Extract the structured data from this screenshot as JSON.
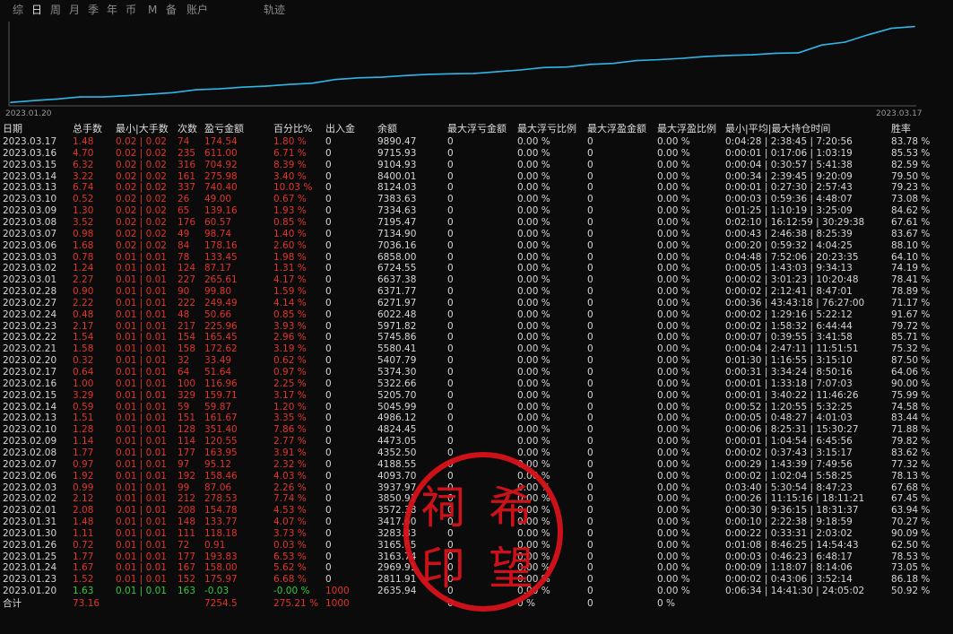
{
  "tabs": [
    {
      "label": "综",
      "active": false
    },
    {
      "label": "日",
      "active": true
    },
    {
      "label": "周",
      "active": false
    },
    {
      "label": "月",
      "active": false
    },
    {
      "label": "季",
      "active": false
    },
    {
      "label": "年",
      "active": false
    },
    {
      "label": "币",
      "active": false
    },
    {
      "label": "M",
      "active": false
    },
    {
      "label": "备",
      "active": false
    },
    {
      "label": "账户",
      "active": false
    },
    {
      "label": "轨迹",
      "active": false
    }
  ],
  "chart": {
    "start_date": "2023.01.20",
    "end_date": "2023.03.17",
    "line_color": "#2fb6e8",
    "background": "#0b0b0b",
    "axis_color": "#5a5a5a"
  },
  "chart_data": {
    "type": "line",
    "x": [
      "2023.01.20",
      "2023.01.23",
      "2023.01.24",
      "2023.01.25",
      "2023.01.26",
      "2023.01.30",
      "2023.01.31",
      "2023.02.01",
      "2023.02.02",
      "2023.02.03",
      "2023.02.06",
      "2023.02.07",
      "2023.02.08",
      "2023.02.09",
      "2023.02.10",
      "2023.02.13",
      "2023.02.14",
      "2023.02.15",
      "2023.02.16",
      "2023.02.17",
      "2023.02.20",
      "2023.02.21",
      "2023.02.22",
      "2023.02.23",
      "2023.02.24",
      "2023.02.27",
      "2023.02.28",
      "2023.03.01",
      "2023.03.02",
      "2023.03.03",
      "2023.03.06",
      "2023.03.07",
      "2023.03.08",
      "2023.03.09",
      "2023.03.10",
      "2023.03.13",
      "2023.03.14",
      "2023.03.15",
      "2023.03.16",
      "2023.03.17"
    ],
    "series": [
      {
        "values": [
          2635.94,
          2811.91,
          2969.91,
          3163.74,
          3165.65,
          3283.83,
          3417.6,
          3572.38,
          3850.91,
          3937.97,
          4093.7,
          4188.55,
          4352.5,
          4473.05,
          4824.45,
          4986.12,
          5045.99,
          5205.7,
          5322.66,
          5374.3,
          5407.79,
          5580.41,
          5745.86,
          5971.82,
          6022.48,
          6271.97,
          6371.77,
          6637.38,
          6724.55,
          6858.0,
          7036.16,
          7134.9,
          7195.47,
          7334.63,
          7383.63,
          8124.03,
          8400.01,
          9104.93,
          9715.93,
          9890.47
        ]
      }
    ]
  },
  "columns": [
    "日期",
    "总手数",
    "最小|大手数",
    "次数",
    "盈亏金额",
    "百分比%",
    "出入金",
    "余额",
    "最大浮亏金额",
    "最大浮亏比例",
    "最大浮盈金额",
    "最大浮盈比例",
    "最小|平均|最大持仓时间",
    "胜率"
  ],
  "rows": [
    [
      "2023.03.17",
      "1.48",
      "0.02 | 0.02",
      "74",
      "174.54",
      "1.80 %",
      "0",
      "9890.47",
      "0",
      "0.00 %",
      "0",
      "0.00 %",
      "0:04:28 | 2:38:45 | 7:20:56",
      "83.78 %"
    ],
    [
      "2023.03.16",
      "4.70",
      "0.02 | 0.02",
      "235",
      "611.00",
      "6.71 %",
      "0",
      "9715.93",
      "0",
      "0.00 %",
      "0",
      "0.00 %",
      "0:00:01 | 0:17:06 | 1:03:19",
      "85.53 %"
    ],
    [
      "2023.03.15",
      "6.32",
      "0.02 | 0.02",
      "316",
      "704.92",
      "8.39 %",
      "0",
      "9104.93",
      "0",
      "0.00 %",
      "0",
      "0.00 %",
      "0:00:04 | 0:30:57 | 5:41:38",
      "82.59 %"
    ],
    [
      "2023.03.14",
      "3.22",
      "0.02 | 0.02",
      "161",
      "275.98",
      "3.40 %",
      "0",
      "8400.01",
      "0",
      "0.00 %",
      "0",
      "0.00 %",
      "0:00:34 | 2:39:45 | 9:20:09",
      "79.50 %"
    ],
    [
      "2023.03.13",
      "6.74",
      "0.02 | 0.02",
      "337",
      "740.40",
      "10.03 %",
      "0",
      "8124.03",
      "0",
      "0.00 %",
      "0",
      "0.00 %",
      "0:00:01 | 0:27:30 | 2:57:43",
      "79.23 %"
    ],
    [
      "2023.03.10",
      "0.52",
      "0.02 | 0.02",
      "26",
      "49.00",
      "0.67 %",
      "0",
      "7383.63",
      "0",
      "0.00 %",
      "0",
      "0.00 %",
      "0:00:03 | 0:59:36 | 4:48:07",
      "73.08 %"
    ],
    [
      "2023.03.09",
      "1.30",
      "0.02 | 0.02",
      "65",
      "139.16",
      "1.93 %",
      "0",
      "7334.63",
      "0",
      "0.00 %",
      "0",
      "0.00 %",
      "0:01:25 | 1:10:19 | 3:25:09",
      "84.62 %"
    ],
    [
      "2023.03.08",
      "3.52",
      "0.02 | 0.02",
      "176",
      "60.57",
      "0.85 %",
      "0",
      "7195.47",
      "0",
      "0.00 %",
      "0",
      "0.00 %",
      "0:02:10 | 16:12:59 | 30:29:38",
      "67.61 %"
    ],
    [
      "2023.03.07",
      "0.98",
      "0.02 | 0.02",
      "49",
      "98.74",
      "1.40 %",
      "0",
      "7134.90",
      "0",
      "0.00 %",
      "0",
      "0.00 %",
      "0:00:43 | 2:46:38 | 8:25:39",
      "83.67 %"
    ],
    [
      "2023.03.06",
      "1.68",
      "0.02 | 0.02",
      "84",
      "178.16",
      "2.60 %",
      "0",
      "7036.16",
      "0",
      "0.00 %",
      "0",
      "0.00 %",
      "0:00:20 | 0:59:32 | 4:04:25",
      "88.10 %"
    ],
    [
      "2023.03.03",
      "0.78",
      "0.01 | 0.01",
      "78",
      "133.45",
      "1.98 %",
      "0",
      "6858.00",
      "0",
      "0.00 %",
      "0",
      "0.00 %",
      "0:04:48 | 7:52:06 | 20:23:35",
      "64.10 %"
    ],
    [
      "2023.03.02",
      "1.24",
      "0.01 | 0.01",
      "124",
      "87.17",
      "1.31 %",
      "0",
      "6724.55",
      "0",
      "0.00 %",
      "0",
      "0.00 %",
      "0:00:05 | 1:43:03 | 9:34:13",
      "74.19 %"
    ],
    [
      "2023.03.01",
      "2.27",
      "0.01 | 0.01",
      "227",
      "265.61",
      "4.17 %",
      "0",
      "6637.38",
      "0",
      "0.00 %",
      "0",
      "0.00 %",
      "0:00:02 | 3:01:23 | 10:20:48",
      "78.41 %"
    ],
    [
      "2023.02.28",
      "0.90",
      "0.01 | 0.01",
      "90",
      "99.80",
      "1.59 %",
      "0",
      "6371.77",
      "0",
      "0.00 %",
      "0",
      "0.00 %",
      "0:00:02 | 2:12:41 | 8:47:01",
      "78.89 %"
    ],
    [
      "2023.02.27",
      "2.22",
      "0.01 | 0.01",
      "222",
      "249.49",
      "4.14 %",
      "0",
      "6271.97",
      "0",
      "0.00 %",
      "0",
      "0.00 %",
      "0:00:36 | 43:43:18 | 76:27:00",
      "71.17 %"
    ],
    [
      "2023.02.24",
      "0.48",
      "0.01 | 0.01",
      "48",
      "50.66",
      "0.85 %",
      "0",
      "6022.48",
      "0",
      "0.00 %",
      "0",
      "0.00 %",
      "0:00:02 | 1:29:16 | 5:22:12",
      "91.67 %"
    ],
    [
      "2023.02.23",
      "2.17",
      "0.01 | 0.01",
      "217",
      "225.96",
      "3.93 %",
      "0",
      "5971.82",
      "0",
      "0.00 %",
      "0",
      "0.00 %",
      "0:00:02 | 1:58:32 | 6:44:44",
      "79.72 %"
    ],
    [
      "2023.02.22",
      "1.54",
      "0.01 | 0.01",
      "154",
      "165.45",
      "2.96 %",
      "0",
      "5745.86",
      "0",
      "0.00 %",
      "0",
      "0.00 %",
      "0:00:07 | 0:39:55 | 3:41:58",
      "85.71 %"
    ],
    [
      "2023.02.21",
      "1.58",
      "0.01 | 0.01",
      "158",
      "172.62",
      "3.19 %",
      "0",
      "5580.41",
      "0",
      "0.00 %",
      "0",
      "0.00 %",
      "0:00:04 | 2:47:11 | 11:51:51",
      "75.32 %"
    ],
    [
      "2023.02.20",
      "0.32",
      "0.01 | 0.01",
      "32",
      "33.49",
      "0.62 %",
      "0",
      "5407.79",
      "0",
      "0.00 %",
      "0",
      "0.00 %",
      "0:01:30 | 1:16:55 | 3:15:10",
      "87.50 %"
    ],
    [
      "2023.02.17",
      "0.64",
      "0.01 | 0.01",
      "64",
      "51.64",
      "0.97 %",
      "0",
      "5374.30",
      "0",
      "0.00 %",
      "0",
      "0.00 %",
      "0:00:31 | 3:34:24 | 8:50:16",
      "64.06 %"
    ],
    [
      "2023.02.16",
      "1.00",
      "0.01 | 0.01",
      "100",
      "116.96",
      "2.25 %",
      "0",
      "5322.66",
      "0",
      "0.00 %",
      "0",
      "0.00 %",
      "0:00:01 | 1:33:18 | 7:07:03",
      "90.00 %"
    ],
    [
      "2023.02.15",
      "3.29",
      "0.01 | 0.01",
      "329",
      "159.71",
      "3.17 %",
      "0",
      "5205.70",
      "0",
      "0.00 %",
      "0",
      "0.00 %",
      "0:00:01 | 3:40:22 | 11:46:26",
      "75.99 %"
    ],
    [
      "2023.02.14",
      "0.59",
      "0.01 | 0.01",
      "59",
      "59.87",
      "1.20 %",
      "0",
      "5045.99",
      "0",
      "0.00 %",
      "0",
      "0.00 %",
      "0:00:52 | 1:20:55 | 5:32:25",
      "74.58 %"
    ],
    [
      "2023.02.13",
      "1.51",
      "0.01 | 0.01",
      "151",
      "161.67",
      "3.35 %",
      "0",
      "4986.12",
      "0",
      "0.00 %",
      "0",
      "0.00 %",
      "0:00:05 | 0:48:27 | 4:01:03",
      "83.44 %"
    ],
    [
      "2023.02.10",
      "1.28",
      "0.01 | 0.01",
      "128",
      "351.40",
      "7.86 %",
      "0",
      "4824.45",
      "0",
      "0.00 %",
      "0",
      "0.00 %",
      "0:00:06 | 8:25:31 | 15:30:27",
      "71.88 %"
    ],
    [
      "2023.02.09",
      "1.14",
      "0.01 | 0.01",
      "114",
      "120.55",
      "2.77 %",
      "0",
      "4473.05",
      "0",
      "0.00 %",
      "0",
      "0.00 %",
      "0:00:01 | 1:04:54 | 6:45:56",
      "79.82 %"
    ],
    [
      "2023.02.08",
      "1.77",
      "0.01 | 0.01",
      "177",
      "163.95",
      "3.91 %",
      "0",
      "4352.50",
      "0",
      "0.00 %",
      "0",
      "0.00 %",
      "0:00:02 | 0:37:43 | 3:15:17",
      "83.62 %"
    ],
    [
      "2023.02.07",
      "0.97",
      "0.01 | 0.01",
      "97",
      "95.12",
      "2.32 %",
      "0",
      "4188.55",
      "0",
      "0.00 %",
      "0",
      "0.00 %",
      "0:00:29 | 1:43:39 | 7:49:56",
      "77.32 %"
    ],
    [
      "2023.02.06",
      "1.92",
      "0.01 | 0.01",
      "192",
      "158.46",
      "4.03 %",
      "0",
      "4093.70",
      "0",
      "0.00 %",
      "0",
      "0.00 %",
      "0:00:02 | 1:02:04 | 5:58:25",
      "78.13 %"
    ],
    [
      "2023.02.03",
      "0.99",
      "0.01 | 0.01",
      "99",
      "87.06",
      "2.26 %",
      "0",
      "3937.97",
      "0",
      "0.00 %",
      "0",
      "0.00 %",
      "0:03:40 | 5:30:54 | 8:47:23",
      "67.68 %"
    ],
    [
      "2023.02.02",
      "2.12",
      "0.01 | 0.01",
      "212",
      "278.53",
      "7.74 %",
      "0",
      "3850.91",
      "0",
      "0.00 %",
      "0",
      "0.00 %",
      "0:00:26 | 11:15:16 | 18:11:21",
      "67.45 %"
    ],
    [
      "2023.02.01",
      "2.08",
      "0.01 | 0.01",
      "208",
      "154.78",
      "4.53 %",
      "0",
      "3572.38",
      "0",
      "0.00 %",
      "0",
      "0.00 %",
      "0:00:30 | 9:36:15 | 18:31:37",
      "63.94 %"
    ],
    [
      "2023.01.31",
      "1.48",
      "0.01 | 0.01",
      "148",
      "133.77",
      "4.07 %",
      "0",
      "3417.60",
      "0",
      "0.00 %",
      "0",
      "0.00 %",
      "0:00:10 | 2:22:38 | 9:18:59",
      "70.27 %"
    ],
    [
      "2023.01.30",
      "1.11",
      "0.01 | 0.01",
      "111",
      "118.18",
      "3.73 %",
      "0",
      "3283.83",
      "0",
      "0.00 %",
      "0",
      "0.00 %",
      "0:00:22 | 0:33:31 | 2:03:02",
      "90.09 %"
    ],
    [
      "2023.01.26",
      "0.72",
      "0.01 | 0.01",
      "72",
      "0.91",
      "0.03 %",
      "0",
      "3165.65",
      "0",
      "0.00 %",
      "0",
      "0.00 %",
      "0:01:08 | 8:46:25 | 14:54:43",
      "62.50 %"
    ],
    [
      "2023.01.25",
      "1.77",
      "0.01 | 0.01",
      "177",
      "193.83",
      "6.53 %",
      "0",
      "3163.74",
      "0",
      "0.00 %",
      "0",
      "0.00 %",
      "0:00:03 | 0:46:23 | 6:48:17",
      "78.53 %"
    ],
    [
      "2023.01.24",
      "1.67",
      "0.01 | 0.01",
      "167",
      "158.00",
      "5.62 %",
      "0",
      "2969.91",
      "0",
      "0.00 %",
      "0",
      "0.00 %",
      "0:00:09 | 1:18:07 | 8:14:06",
      "73.05 %"
    ],
    [
      "2023.01.23",
      "1.52",
      "0.01 | 0.01",
      "152",
      "175.97",
      "6.68 %",
      "0",
      "2811.91",
      "0",
      "0.00 %",
      "0",
      "0.00 %",
      "0:00:02 | 0:43:06 | 3:52:14",
      "86.18 %"
    ],
    [
      "2023.01.20",
      "1.63",
      "0.01 | 0.01",
      "163",
      "-0.03",
      "-0.00 %",
      "1000",
      "2635.94",
      "0",
      "0.00 %",
      "0",
      "0.00 %",
      "0:06:34 | 14:41:30 | 24:05:02",
      "50.92 %"
    ]
  ],
  "total": [
    "合计",
    "73.16",
    "",
    "",
    "7254.5",
    "275.21 %",
    "1000",
    "",
    "0",
    "0 %",
    "0",
    "0 %",
    "",
    ""
  ],
  "stamp": {
    "chars": [
      "祠",
      "希",
      "印",
      "望"
    ],
    "color": "#d8121a"
  },
  "colors": {
    "profit": "#e0342c",
    "loss": "#37c83a",
    "text": "#d6d6d6"
  }
}
